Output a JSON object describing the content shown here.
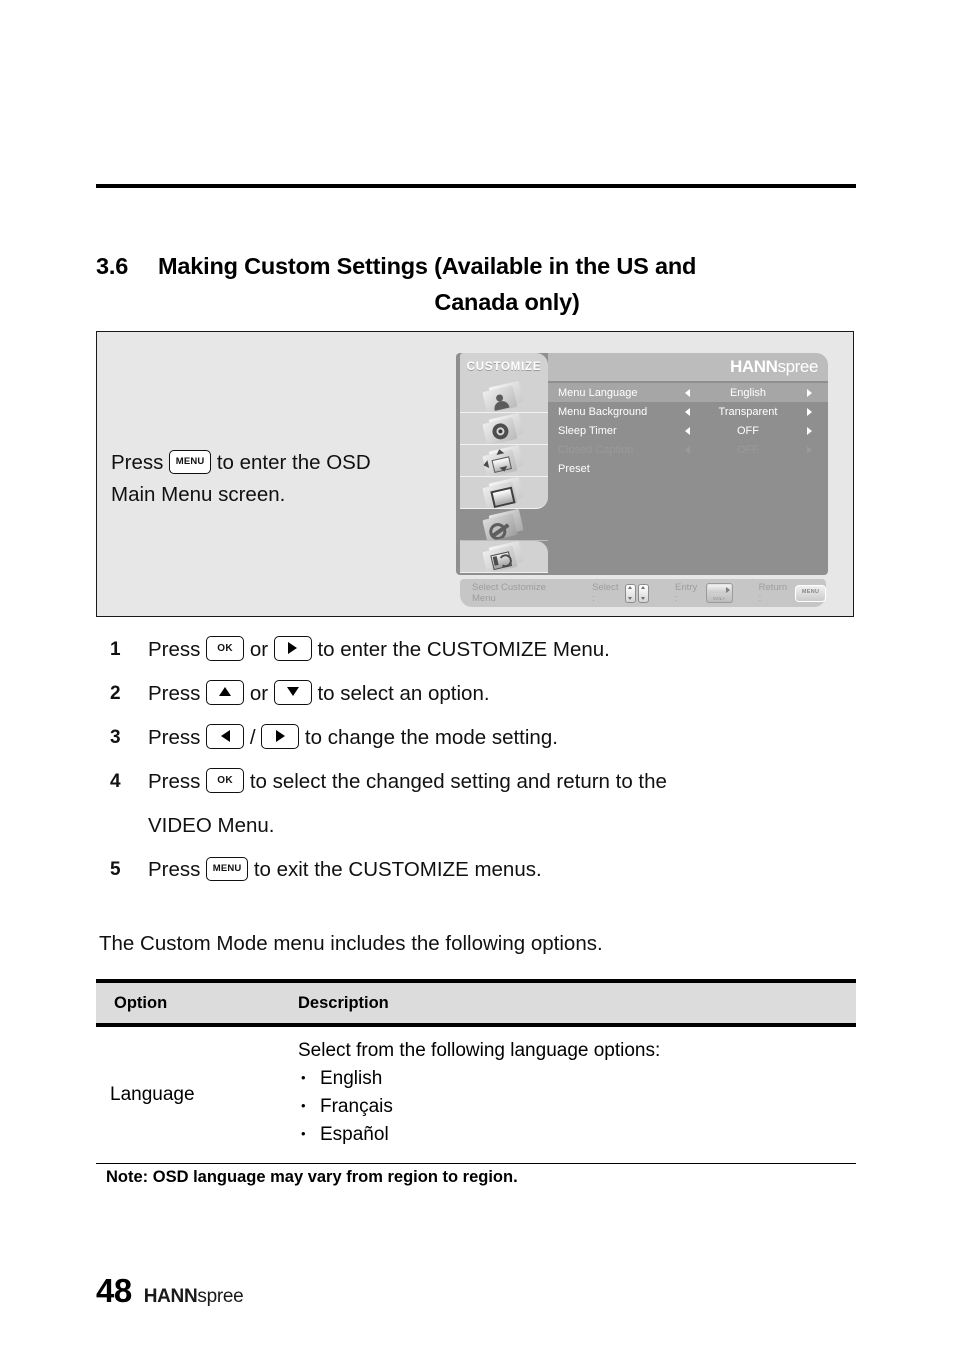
{
  "document": {
    "section_number": "3.6",
    "heading_line1": "Making Custom Settings (Available in the US and",
    "heading_line2": "Canada only)",
    "page_number": "48",
    "brand_bold": "HANN",
    "brand_light": "spree"
  },
  "illustration": {
    "caption_before": "Press",
    "caption_key": "MENU",
    "caption_after_line1": "to enter the OSD",
    "caption_line2": "Main Menu screen."
  },
  "osd": {
    "tab_label": "CUSTOMIZE",
    "logo_bold": "HANN",
    "logo_light": "spree",
    "rail_icons": [
      {
        "name": "picture-icon"
      },
      {
        "name": "sound-icon"
      },
      {
        "name": "position-icon"
      },
      {
        "name": "screen-icon"
      },
      {
        "name": "tools-wrench-icon"
      },
      {
        "name": "setup-icon"
      }
    ],
    "rows": [
      {
        "label": "Menu Language",
        "value": "English",
        "active": true,
        "disabled": false,
        "arrows": true
      },
      {
        "label": "Menu Background",
        "value": "Transparent",
        "active": false,
        "disabled": false,
        "arrows": true
      },
      {
        "label": "Sleep Timer",
        "value": "OFF",
        "active": false,
        "disabled": false,
        "arrows": true
      },
      {
        "label": "Closed Caption",
        "value": "OFF",
        "active": false,
        "disabled": true,
        "arrows": true
      },
      {
        "label": "Preset",
        "value": "",
        "active": false,
        "disabled": false,
        "arrows": false
      }
    ],
    "footer": {
      "hint": "Select Customize Menu",
      "select_label": "Select :",
      "entry_label": "Entry :",
      "entry_button_text": "VOL+",
      "return_label": "Return :",
      "return_button_text": "MENU"
    }
  },
  "steps": [
    {
      "num": "1",
      "parts": [
        "Press",
        "or",
        "to enter the CUSTOMIZE Menu."
      ],
      "keys": [
        "OK",
        "right-arrow"
      ]
    },
    {
      "num": "2",
      "parts": [
        "Press",
        "or",
        "to select an option."
      ],
      "keys": [
        "up-arrow",
        "down-arrow"
      ]
    },
    {
      "num": "3",
      "parts": [
        "Press",
        "/",
        "to change the mode setting."
      ],
      "keys": [
        "left-arrow",
        "right-arrow"
      ]
    },
    {
      "num": "4",
      "parts": [
        "Press",
        "",
        "to select the changed setting and return to the"
      ],
      "continuation": "VIDEO Menu.",
      "keys": [
        "OK"
      ]
    },
    {
      "num": "5",
      "parts": [
        "Press",
        "",
        "to exit the CUSTOMIZE menus."
      ],
      "keys": [
        "MENU"
      ]
    }
  ],
  "intro_sentence": "The Custom Mode menu includes the following options.",
  "table": {
    "headers": [
      "Option",
      "Description"
    ],
    "rows": [
      {
        "option": "Language",
        "description_intro": "Select from the following language options:",
        "bullets": [
          "English",
          "Français",
          "Español"
        ]
      }
    ]
  },
  "note": "Note: OSD language may vary from region to region.",
  "colors": {
    "illustration_bg": "#e7e7e7",
    "osd_body": "#8f8f8f",
    "osd_tab": "#d2d2d2",
    "osd_header": "#bcbcbc",
    "osd_row_active": "#a6a6a6",
    "osd_footer": "#c6c6c6",
    "table_header_bg": "#dcdcdc"
  }
}
